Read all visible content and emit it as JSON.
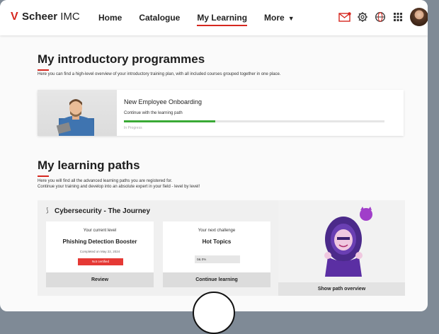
{
  "app": {
    "logo_bold": "Scheer",
    "logo_rest": " IMC"
  },
  "nav": [
    {
      "label": "Home"
    },
    {
      "label": "Catalogue"
    },
    {
      "label": "My Learning"
    },
    {
      "label": "More"
    }
  ],
  "icons": [
    "mail-icon",
    "gear-icon",
    "globe-icon",
    "grid-icon"
  ],
  "intro": {
    "title": "My introductory programmes",
    "desc": "Here you can find a high-level overview of your introductory training plan, with all included courses grouped together in one place.",
    "card": {
      "title": "New Employee Onboarding",
      "subtitle": "Continue with the learning path",
      "progress_fraction": 0.35,
      "status": "In Progress"
    }
  },
  "paths": {
    "title": "My learning paths",
    "desc1": "Here you will find all the advanced learning paths you are registered for.",
    "desc2": "Continue your training and develop into an absolute expert in your field - level by level!",
    "card": {
      "title": "Cybersecurity - The Journey",
      "current": {
        "head": "Your current level",
        "name": "Phishing Detection Booster",
        "completed": "Completed on May 22, 2024",
        "badge": "Not certified",
        "button": "Review"
      },
      "next": {
        "head": "Your next challenge",
        "name": "Hot Topics",
        "progress_text": "0& 0%",
        "button": "Continue learning"
      }
    },
    "hero_button": "Show path overview"
  },
  "colors": {
    "accent": "#d6271f",
    "progress": "#3aaa35",
    "badge": "#e53935"
  }
}
